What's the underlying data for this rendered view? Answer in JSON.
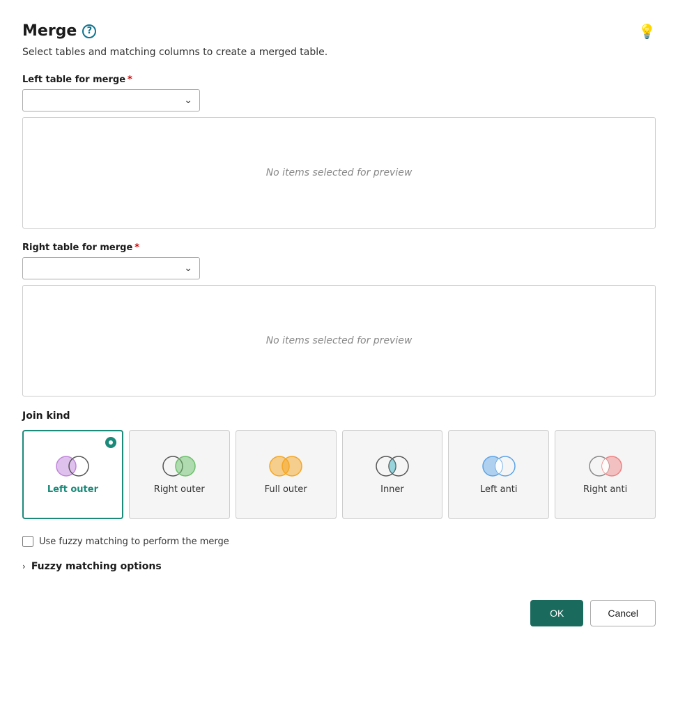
{
  "title": "Merge",
  "subtitle": "Select tables and matching columns to create a merged table.",
  "help_icon_label": "?",
  "bulb_icon": "💡",
  "left_table": {
    "label": "Left table for merge",
    "required": true,
    "placeholder": "",
    "preview_text": "No items selected for preview"
  },
  "right_table": {
    "label": "Right table for merge",
    "required": true,
    "placeholder": "",
    "preview_text": "No items selected for preview"
  },
  "join_kind": {
    "label": "Join kind",
    "options": [
      {
        "id": "left-outer",
        "label": "Left outer",
        "selected": true
      },
      {
        "id": "right-outer",
        "label": "Right outer",
        "selected": false
      },
      {
        "id": "full-outer",
        "label": "Full outer",
        "selected": false
      },
      {
        "id": "inner",
        "label": "Inner",
        "selected": false
      },
      {
        "id": "left-anti",
        "label": "Left anti",
        "selected": false
      },
      {
        "id": "right-anti",
        "label": "Right anti",
        "selected": false
      }
    ]
  },
  "fuzzy_checkbox": {
    "label": "Use fuzzy matching to perform the merge",
    "checked": false
  },
  "fuzzy_options": {
    "label": "Fuzzy matching options"
  },
  "buttons": {
    "ok": "OK",
    "cancel": "Cancel"
  },
  "colors": {
    "selected_border": "#1a8a7a",
    "ok_bg": "#1a6b5e"
  }
}
